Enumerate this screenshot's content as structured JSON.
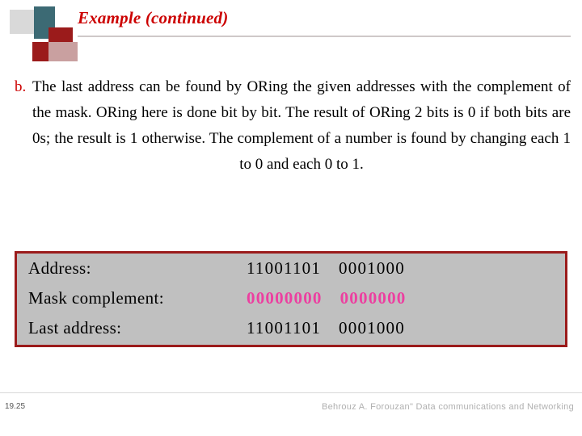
{
  "header": {
    "title": "Example (continued)"
  },
  "content": {
    "bullet_label": "b.",
    "paragraph": "The last address can be found by ORing the given addresses with the complement of the mask. ORing here is done bit by bit. The result of ORing 2 bits is 0 if both bits are 0s; the result is 1 otherwise. The complement of a number is found by changing each 1 to 0 and each 0 to 1."
  },
  "figure": {
    "rows": [
      {
        "label": "Address:",
        "bits": [
          "11001101",
          "0001000"
        ],
        "style": "normal"
      },
      {
        "label": "Mask complement:",
        "bits": [
          "00000000",
          "0000000"
        ],
        "style": "pink"
      },
      {
        "label": "Last address:",
        "bits": [
          "11001101",
          "0001000"
        ],
        "style": "normal"
      }
    ]
  },
  "footer": {
    "slide_number": "19.25",
    "credit": "Behrouz A. Forouzan\" Data communications and Networking"
  }
}
